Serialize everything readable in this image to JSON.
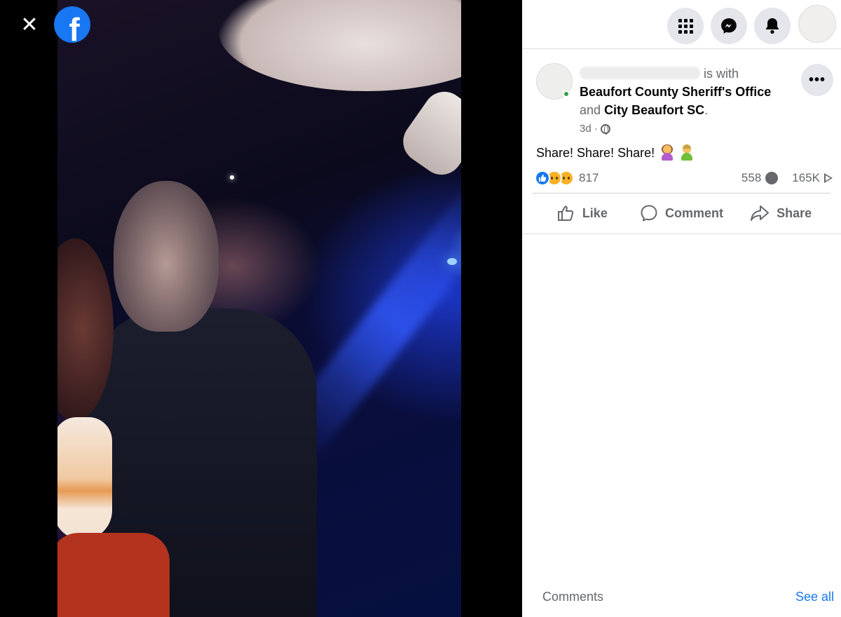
{
  "viewer": {
    "close_icon": "close-icon",
    "logo_icon": "facebook-logo",
    "logo_letter": "f",
    "close_glyph": "✕"
  },
  "topbar": {
    "icons": [
      "menu-grid-icon",
      "messenger-icon",
      "notifications-bell-icon",
      "profile-avatar"
    ]
  },
  "post": {
    "author_suffix": "is with",
    "tagged_1": "Beaufort County Sheriff's Office",
    "and_text": "and",
    "tagged_2": "City Beaufort SC",
    "period": ".",
    "time": "3d",
    "dot": "·",
    "privacy_icon": "globe-icon",
    "more_label": "•••",
    "text": "Share! Share! Share!",
    "emojis": [
      "woman-shrugging-emoji",
      "man-facepalming-emoji"
    ]
  },
  "stats": {
    "reaction_icons": [
      "like",
      "wow",
      "sad"
    ],
    "reactions_count": "817",
    "comments_count": "558",
    "views_count": "165K"
  },
  "actions": {
    "like": "Like",
    "comment": "Comment",
    "share": "Share"
  },
  "footer": {
    "comments_label": "Comments",
    "see_all": "See all"
  },
  "colors": {
    "accent": "#1877f2",
    "muted_text": "#65676b",
    "button_bg": "#e4e6eb",
    "online": "#31a24c"
  }
}
